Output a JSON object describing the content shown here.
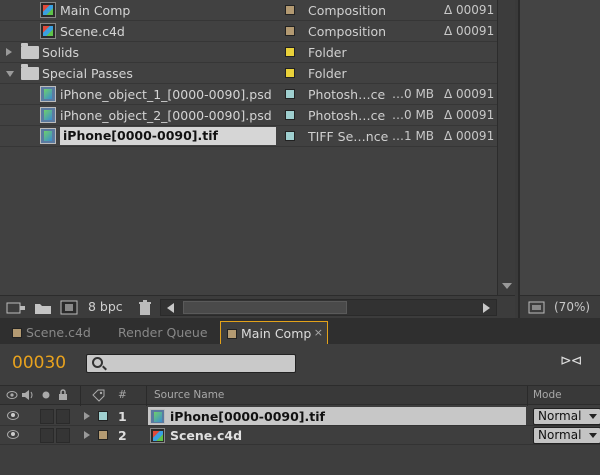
{
  "project": {
    "items": [
      {
        "kind": "comp",
        "indent": 40,
        "name": "Main Comp",
        "swatch": "#b39a72",
        "type": "Composition",
        "size": "",
        "frames": "Δ 00091",
        "selected": false,
        "icon": "composition-icon"
      },
      {
        "kind": "comp",
        "indent": 40,
        "name": "Scene.c4d",
        "swatch": "#b39a72",
        "type": "Composition",
        "size": "",
        "frames": "Δ 00091",
        "selected": false,
        "icon": "composition-icon"
      },
      {
        "kind": "folder",
        "indent": 22,
        "name": "Solids",
        "swatch": "#e9d13a",
        "type": "Folder",
        "size": "",
        "frames": "",
        "selected": false,
        "icon": "folder-icon",
        "expanded": false
      },
      {
        "kind": "folder",
        "indent": 22,
        "name": "Special Passes",
        "swatch": "#e9d13a",
        "type": "Folder",
        "size": "",
        "frames": "",
        "selected": false,
        "icon": "folder-icon",
        "expanded": true
      },
      {
        "kind": "footage",
        "indent": 40,
        "name": "iPhone_object_1_[0000-0090].psd",
        "swatch": "#9fcfcf",
        "type": "Photosh…ce",
        "size": "…0 MB",
        "frames": "Δ 00091",
        "selected": false,
        "icon": "footage-icon"
      },
      {
        "kind": "footage",
        "indent": 40,
        "name": "iPhone_object_2_[0000-0090].psd",
        "swatch": "#9fcfcf",
        "type": "Photosh…ce",
        "size": "…0 MB",
        "frames": "Δ 00091",
        "selected": false,
        "icon": "footage-icon"
      },
      {
        "kind": "footage",
        "indent": 40,
        "name": "iPhone[0000-0090].tif",
        "swatch": "#9fcfcf",
        "type": "TIFF Se…nce",
        "size": "…1 MB",
        "frames": "Δ 00091",
        "selected": true,
        "icon": "footage-icon"
      }
    ],
    "footer": {
      "bpc_label": "8 bpc"
    }
  },
  "viewer": {
    "zoom": "(70%)"
  },
  "tabs": [
    {
      "label": "Scene.c4d",
      "active": false,
      "swatch": true
    },
    {
      "label": "Render Queue",
      "active": false,
      "swatch": false
    },
    {
      "label": "Main Comp",
      "active": true,
      "swatch": true,
      "close": "×"
    }
  ],
  "timeline": {
    "timecode": "00030",
    "search_placeholder": "",
    "columns": {
      "number": "#",
      "source_name": "Source Name",
      "mode": "Mode"
    },
    "layers": [
      {
        "number": "1",
        "name": "iPhone[0000-0090].tif",
        "swatch": "#9fcfcf",
        "mode": "Normal",
        "selected": true,
        "icon": "footage-icon"
      },
      {
        "number": "2",
        "name": "Scene.c4d",
        "swatch": "#b39a72",
        "mode": "Normal",
        "selected": false,
        "icon": "composition-icon"
      }
    ]
  }
}
